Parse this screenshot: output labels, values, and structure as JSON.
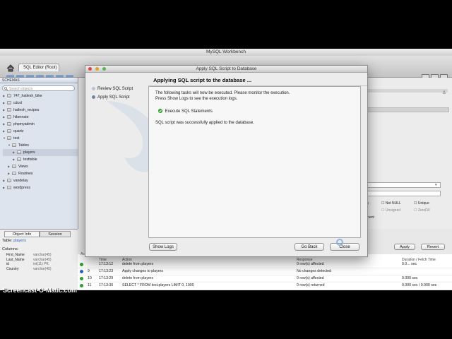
{
  "app": {
    "title": "MySQL Workbench",
    "tab": "SQL Editor (Root)"
  },
  "sidebar": {
    "header": "SCHEMAS",
    "search_placeholder": "Search objects",
    "items": [
      {
        "label": "747_hatlesh_bike",
        "expanded": false
      },
      {
        "label": "cdcol",
        "expanded": false
      },
      {
        "label": "hatlesh_recipes",
        "expanded": false
      },
      {
        "label": "hibernate",
        "expanded": false
      },
      {
        "label": "phpmyadmin",
        "expanded": false
      },
      {
        "label": "quartz",
        "expanded": false
      },
      {
        "label": "test",
        "expanded": true
      },
      {
        "label": "Tables",
        "expanded": true
      },
      {
        "label": "players",
        "expanded": false,
        "selected": true
      },
      {
        "label": "testtable",
        "expanded": false
      },
      {
        "label": "Views",
        "expanded": false
      },
      {
        "label": "Routines",
        "expanded": false
      },
      {
        "label": "vandelay",
        "expanded": false
      },
      {
        "label": "wordpress",
        "expanded": false
      }
    ]
  },
  "object_info": {
    "tabs": [
      "Object Info",
      "Session"
    ],
    "table_label": "Table:",
    "table_name": "players",
    "columns_label": "Columns:",
    "columns": [
      {
        "name": "First_Name",
        "type": "varchar(45)"
      },
      {
        "name": "Last_Name",
        "type": "varchar(45)"
      },
      {
        "name": "id",
        "type": "int(11) PK"
      },
      {
        "name": "Country",
        "type": "varchar(45)"
      }
    ]
  },
  "right_panel": {
    "checkboxes": [
      "Not NULL",
      "Unique",
      "Unsigned",
      "ZeroFill"
    ],
    "partial_labels": [
      "lay",
      "ement"
    ],
    "apply_label": "Apply",
    "revert_label": "Revert"
  },
  "output": {
    "title": "Action Output",
    "headers": {
      "time": "Time",
      "action": "Action",
      "response": "Response",
      "duration": "Duration / Fetch Time"
    },
    "rows": [
      {
        "num": "",
        "time": "17:13:12",
        "action": "delete from players",
        "response": "0 row(s) affected",
        "duration": "0.0... sec",
        "status": "ok"
      },
      {
        "num": "9",
        "time": "17:13:23",
        "action": "Apply changes to players",
        "response": "No changes detected",
        "duration": "",
        "status": "info"
      },
      {
        "num": "10",
        "time": "17:13:29",
        "action": "delete from players",
        "response": "0 row(s) affected",
        "duration": "0.000 sec",
        "status": "ok"
      },
      {
        "num": "11",
        "time": "17:13:30",
        "action": "SELECT * FROM test.players LIMIT 0, 1000",
        "response": "0 row(s) returned",
        "duration": "0.000 sec / 0.000 sec",
        "status": "ok"
      }
    ]
  },
  "dialog": {
    "title": "Apply SQL Script to Database",
    "steps": [
      "Review SQL Script",
      "Apply SQL Script"
    ],
    "heading": "Applying SQL script to the database ...",
    "description_line1": "The following tasks will now be executed. Please monitor the execution.",
    "description_line2": "Press Show Logs to see the execution logs.",
    "task": "Execute SQL Statements",
    "result": "SQL script was successfully applied to the database.",
    "show_logs": "Show Logs",
    "go_back": "Go Back",
    "close": "Close"
  },
  "watermark": "Screencast-O-Matic.com",
  "colors": {
    "success": "#2e9e2e",
    "info": "#2a62c9",
    "selection": "#c7d0dc"
  }
}
